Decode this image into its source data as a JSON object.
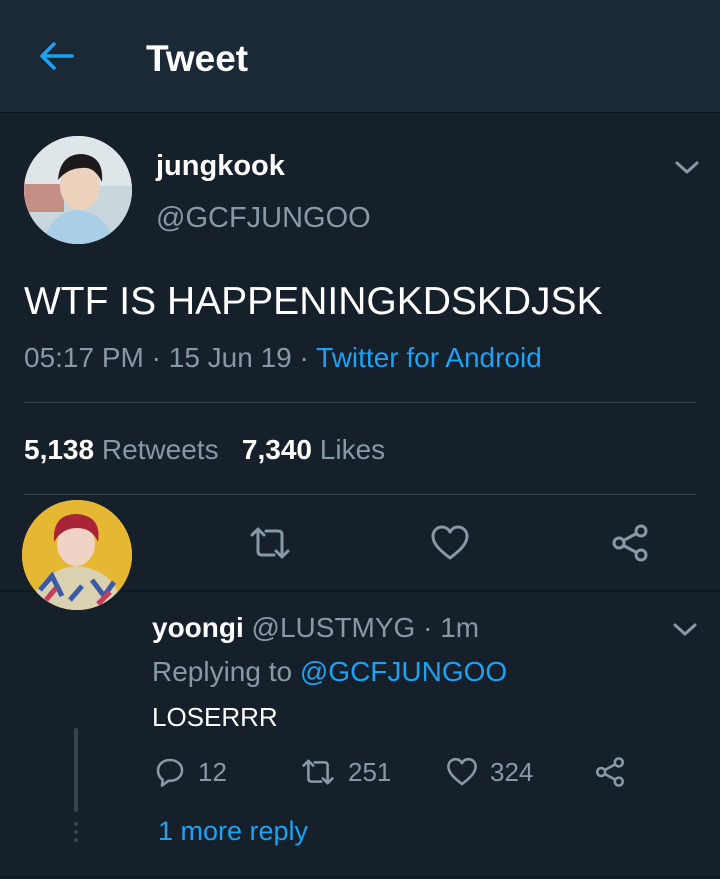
{
  "header": {
    "title": "Tweet",
    "back_icon": "arrow-left-icon"
  },
  "tweet": {
    "display_name": "jungkook",
    "handle": "@GCFJUNGOO",
    "text": "WTF IS HAPPENINGKDSKDJSK",
    "time": "05:17 PM",
    "sep1": " · ",
    "date": "15 Jun 19",
    "sep2": " · ",
    "source": "Twitter for Android",
    "retweets": "5,138",
    "retweets_label": "Retweets",
    "likes": "7,340",
    "likes_label": "Likes"
  },
  "reply": {
    "display_name": "yoongi",
    "handle": "@LUSTMYG",
    "sep": " · ",
    "time": "1m",
    "replying_prefix": "Replying to ",
    "replying_to": "@GCFJUNGOO",
    "text": "LOSERRR",
    "reply_count": "12",
    "retweet_count": "251",
    "like_count": "324",
    "more_replies": "1 more reply"
  },
  "colors": {
    "background": "#15202b",
    "header": "#1b2836",
    "accent": "#1da1f2",
    "secondary_text": "#8899a6",
    "divider": "#38444d"
  }
}
